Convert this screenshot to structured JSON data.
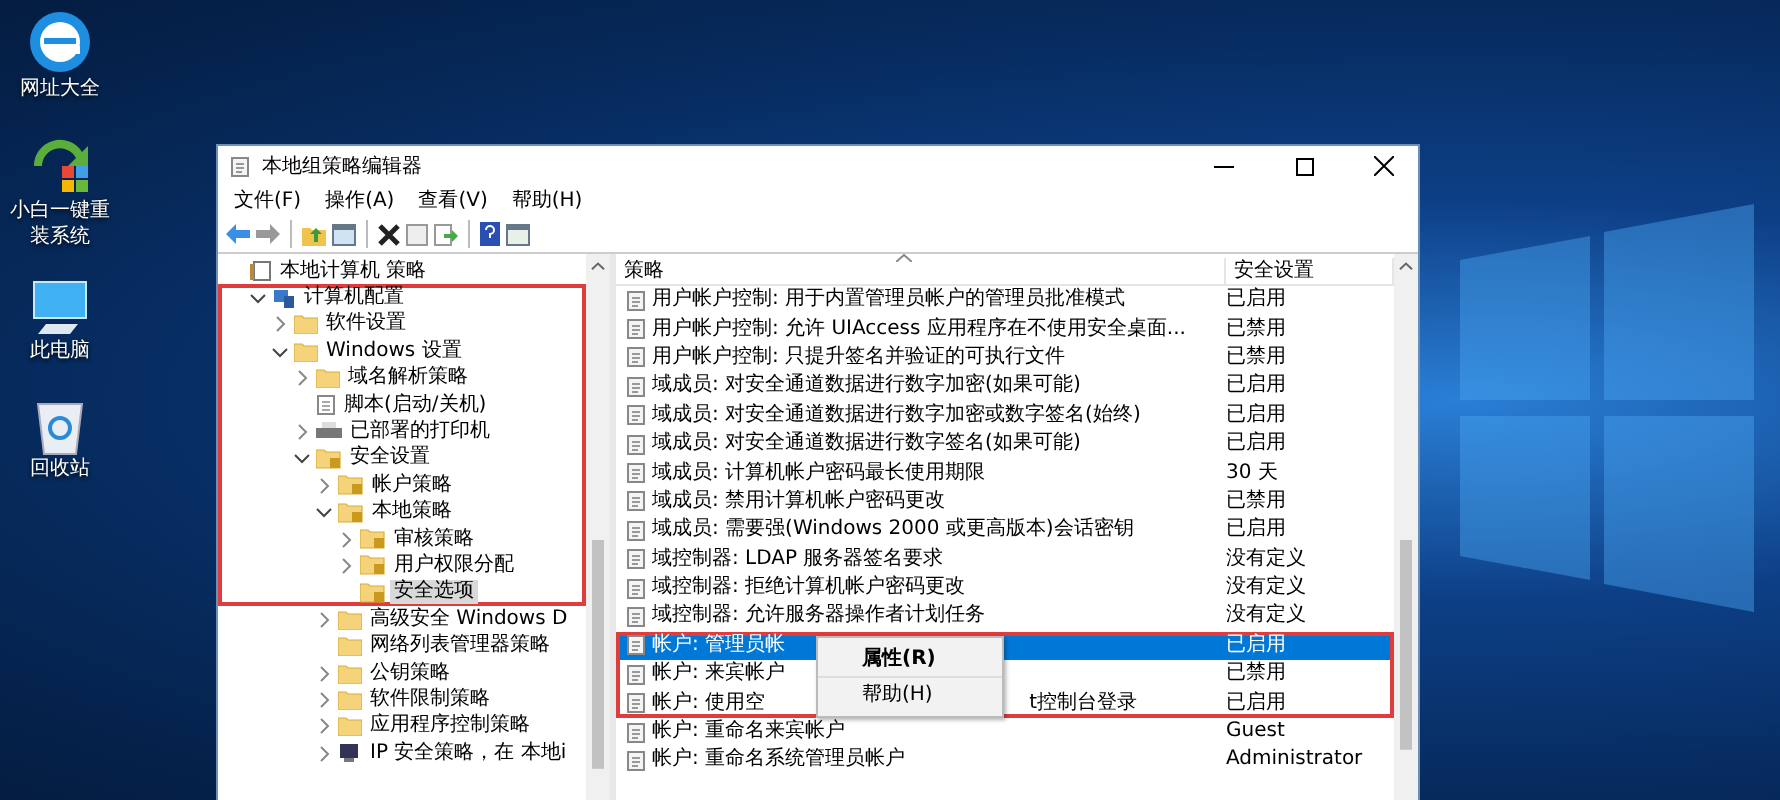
{
  "desktop": {
    "icons": [
      {
        "kind": "browser",
        "label": "网址大全"
      },
      {
        "kind": "installer",
        "label": "小白一键重装系统"
      },
      {
        "kind": "computer",
        "label": "此电脑"
      },
      {
        "kind": "recycle",
        "label": "回收站"
      }
    ]
  },
  "window": {
    "title": "本地组策略编辑器",
    "menu": [
      "文件(F)",
      "操作(A)",
      "查看(V)",
      "帮助(H)"
    ],
    "tree": [
      {
        "label": "本地计算机 策略",
        "kind": "policy",
        "expandable": false,
        "selected": false,
        "marked": false,
        "children": [
          {
            "label": "计算机配置",
            "kind": "computer",
            "expandable": true,
            "expanded": true,
            "selected": false,
            "marked": true,
            "children": [
              {
                "label": "软件设置",
                "kind": "folder",
                "expandable": true,
                "expanded": false,
                "selected": false,
                "marked": true
              },
              {
                "label": "Windows 设置",
                "kind": "folder",
                "expandable": true,
                "expanded": true,
                "selected": false,
                "marked": true,
                "children": [
                  {
                    "label": "域名解析策略",
                    "kind": "folder",
                    "expandable": true,
                    "expanded": false,
                    "selected": false,
                    "marked": true
                  },
                  {
                    "label": "脚本(启动/关机)",
                    "kind": "script",
                    "expandable": false,
                    "selected": false,
                    "marked": true
                  },
                  {
                    "label": "已部署的打印机",
                    "kind": "printer",
                    "expandable": true,
                    "expanded": false,
                    "selected": false,
                    "marked": true
                  },
                  {
                    "label": "安全设置",
                    "kind": "secure",
                    "expandable": true,
                    "expanded": true,
                    "selected": false,
                    "marked": true,
                    "children": [
                      {
                        "label": "帐户策略",
                        "kind": "secure",
                        "expandable": true,
                        "expanded": false,
                        "selected": false,
                        "marked": true
                      },
                      {
                        "label": "本地策略",
                        "kind": "secure",
                        "expandable": true,
                        "expanded": true,
                        "selected": false,
                        "marked": true,
                        "children": [
                          {
                            "label": "审核策略",
                            "kind": "secure",
                            "expandable": true,
                            "expanded": false,
                            "selected": false,
                            "marked": true
                          },
                          {
                            "label": "用户权限分配",
                            "kind": "secure",
                            "expandable": true,
                            "expanded": false,
                            "selected": false,
                            "marked": true
                          },
                          {
                            "label": "安全选项",
                            "kind": "secure",
                            "expandable": false,
                            "selected": true,
                            "marked": true
                          }
                        ]
                      },
                      {
                        "label": "高级安全 Windows D",
                        "kind": "folder",
                        "expandable": true,
                        "expanded": false,
                        "selected": false,
                        "marked": false
                      },
                      {
                        "label": "网络列表管理器策略",
                        "kind": "folder",
                        "expandable": false,
                        "selected": false,
                        "marked": false
                      },
                      {
                        "label": "公钥策略",
                        "kind": "folder",
                        "expandable": true,
                        "expanded": false,
                        "selected": false,
                        "marked": false
                      },
                      {
                        "label": "软件限制策略",
                        "kind": "folder",
                        "expandable": true,
                        "expanded": false,
                        "selected": false,
                        "marked": false
                      },
                      {
                        "label": "应用程序控制策略",
                        "kind": "folder",
                        "expandable": true,
                        "expanded": false,
                        "selected": false,
                        "marked": false
                      },
                      {
                        "label": "IP 安全策略，在 本地i",
                        "kind": "ip",
                        "expandable": true,
                        "expanded": false,
                        "selected": false,
                        "marked": false
                      }
                    ]
                  }
                ]
              }
            ]
          }
        ]
      }
    ],
    "list": {
      "columns": [
        "策略",
        "安全设置"
      ],
      "rows": [
        {
          "name": "用户帐户控制: 用于内置管理员帐户的管理员批准模式",
          "setting": "已启用",
          "selected": false,
          "marked": false
        },
        {
          "name": "用户帐户控制: 允许 UIAccess 应用程序在不使用安全桌面...",
          "setting": "已禁用",
          "selected": false,
          "marked": false
        },
        {
          "name": "用户帐户控制: 只提升签名并验证的可执行文件",
          "setting": "已禁用",
          "selected": false,
          "marked": false
        },
        {
          "name": "域成员: 对安全通道数据进行数字加密(如果可能)",
          "setting": "已启用",
          "selected": false,
          "marked": false
        },
        {
          "name": "域成员: 对安全通道数据进行数字加密或数字签名(始终)",
          "setting": "已启用",
          "selected": false,
          "marked": false
        },
        {
          "name": "域成员: 对安全通道数据进行数字签名(如果可能)",
          "setting": "已启用",
          "selected": false,
          "marked": false
        },
        {
          "name": "域成员: 计算机帐户密码最长使用期限",
          "setting": "30 天",
          "selected": false,
          "marked": false
        },
        {
          "name": "域成员: 禁用计算机帐户密码更改",
          "setting": "已禁用",
          "selected": false,
          "marked": false
        },
        {
          "name": "域成员: 需要强(Windows 2000 或更高版本)会话密钥",
          "setting": "已启用",
          "selected": false,
          "marked": false
        },
        {
          "name": "域控制器: LDAP 服务器签名要求",
          "setting": "没有定义",
          "selected": false,
          "marked": false
        },
        {
          "name": "域控制器: 拒绝计算机帐户密码更改",
          "setting": "没有定义",
          "selected": false,
          "marked": false
        },
        {
          "name": "域控制器: 允许服务器操作者计划任务",
          "setting": "没有定义",
          "selected": false,
          "marked": false
        },
        {
          "name": "帐户: 管理员帐",
          "setting": "已启用",
          "selected": true,
          "marked": true
        },
        {
          "name": "帐户: 来宾帐户",
          "setting": "已禁用",
          "selected": false,
          "marked": true
        },
        {
          "name": "帐户: 使用空",
          "name_tail": "t控制台登录",
          "setting": "已启用",
          "selected": false,
          "marked": true
        },
        {
          "name": "帐户: 重命名来宾帐户",
          "setting": "Guest",
          "selected": false,
          "marked": false
        },
        {
          "name": "帐户: 重命名系统管理员帐户",
          "setting": "Administrator",
          "selected": false,
          "marked": false
        }
      ]
    },
    "context_menu": {
      "items": [
        {
          "label": "属性(R)",
          "default": true
        },
        {
          "label": "帮助(H)",
          "default": false
        }
      ]
    }
  }
}
